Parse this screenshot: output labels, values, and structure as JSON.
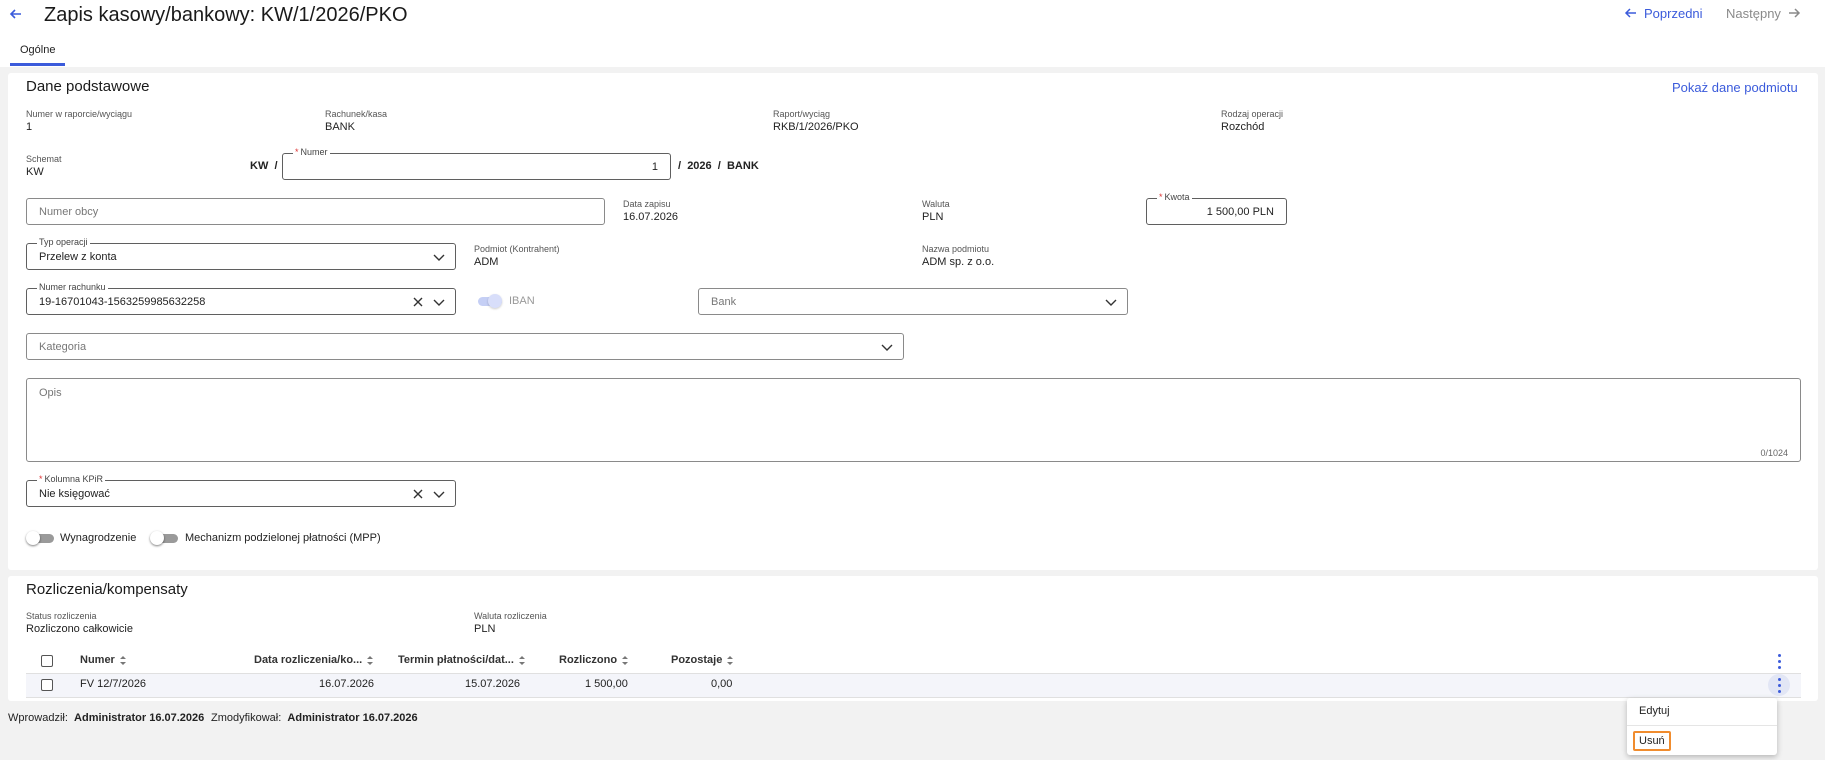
{
  "header": {
    "title": "Zapis kasowy/bankowy: KW/1/2026/PKO",
    "prev_label": "Poprzedni",
    "next_label": "Następny"
  },
  "tabs": [
    {
      "label": "Ogólne",
      "active": true
    }
  ],
  "basic": {
    "title": "Dane podstawowe",
    "show_entity_link": "Pokaż dane podmiotu",
    "nr_w_raporcie_label": "Numer w raporcie/wyciągu",
    "nr_w_raporcie_value": "1",
    "rachunek_label": "Rachunek/kasa",
    "rachunek_value": "BANK",
    "raport_label": "Raport/wyciąg",
    "raport_value": "RKB/1/2026/PKO",
    "rodzaj_label": "Rodzaj operacji",
    "rodzaj_value": "Rozchód",
    "schemat_label": "Schemat",
    "schemat_value": "KW",
    "prefix": "KW",
    "sep1": "/",
    "numer_label": "Numer",
    "numer_value": "1",
    "sep2": "/",
    "year": "2026",
    "sep3": "/",
    "suffix": "BANK",
    "numer_obcy_placeholder": "Numer obcy",
    "data_zapisu_label": "Data zapisu",
    "data_zapisu_value": "16.07.2026",
    "waluta_label": "Waluta",
    "waluta_value": "PLN",
    "kwota_label": "Kwota",
    "kwota_value": "1 500,00 PLN",
    "typ_operacji_label": "Typ operacji",
    "typ_operacji_value": "Przelew z konta",
    "podmiot_label": "Podmiot (Kontrahent)",
    "podmiot_value": "ADM",
    "nazwa_podmiotu_label": "Nazwa podmiotu",
    "nazwa_podmiotu_value": "ADM sp. z o.o.",
    "numer_rachunku_label": "Numer rachunku",
    "numer_rachunku_value": "19-16701043-1563259985632258",
    "iban_label": "IBAN",
    "iban_on": true,
    "bank_placeholder": "Bank",
    "kategoria_placeholder": "Kategoria",
    "opis_placeholder": "Opis",
    "opis_counter": "0/1024",
    "kolumna_label": "Kolumna KPiR",
    "kolumna_value": "Nie księgować",
    "wynagrodzenie_label": "Wynagrodzenie",
    "mpp_label": "Mechanizm podzielonej płatności (MPP)"
  },
  "settlements": {
    "title": "Rozliczenia/kompensaty",
    "status_label": "Status rozliczenia",
    "status_value": "Rozliczono całkowicie",
    "waluta_label": "Waluta rozliczenia",
    "waluta_value": "PLN",
    "columns": [
      "Numer",
      "Data rozliczenia/ko...",
      "Termin płatności/dat...",
      "Rozliczono",
      "Pozostaje"
    ],
    "rows": [
      {
        "numer": "FV 12/7/2026",
        "data": "16.07.2026",
        "termin": "15.07.2026",
        "rozliczono": "1 500,00",
        "pozostaje": "0,00"
      }
    ]
  },
  "footer": {
    "wprowadzil_label": "Wprowadził:",
    "wprowadzil_value": "Administrator 16.07.2026",
    "zmodyfikowal_label": "Zmodyfikował:",
    "zmodyfikowal_value": "Administrator 16.07.2026"
  },
  "context_menu": {
    "edit": "Edytuj",
    "delete": "Usuń"
  },
  "colors": {
    "accent": "#3b5bdb",
    "required": "#d33333",
    "highlight": "#f08c2e"
  }
}
